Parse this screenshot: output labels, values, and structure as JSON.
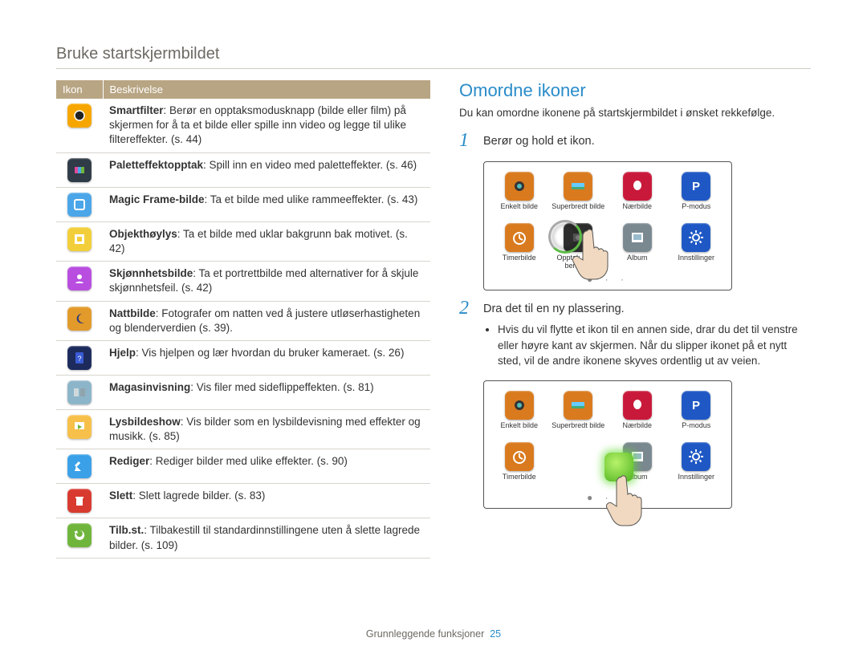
{
  "pageTitle": "Bruke startskjermbildet",
  "footer": {
    "section": "Grunnleggende funksjoner",
    "page": "25"
  },
  "table": {
    "headers": {
      "icon": "Ikon",
      "desc": "Beskrivelse"
    },
    "rows": [
      {
        "term": "Smartfilter",
        "text": ": Berør en opptaksmodusknapp (bilde eller film) på skjermen for å ta et bilde eller spille inn video og legge til ulike filtereffekter. (s. 44)"
      },
      {
        "term": "Paletteffektopptak",
        "text": ": Spill inn en video med paletteffekter. (s. 46)"
      },
      {
        "term": "Magic Frame-bilde",
        "text": ": Ta et bilde med ulike rammeeffekter. (s. 43)"
      },
      {
        "term": "Objekthøylys",
        "text": ": Ta et bilde med uklar bakgrunn bak motivet. (s. 42)"
      },
      {
        "term": "Skjønnhetsbilde",
        "text": ": Ta et portrettbilde med alternativer for å skjule skjønnhetsfeil. (s. 42)"
      },
      {
        "term": "Nattbilde",
        "text": ": Fotografer om natten ved å justere utløserhastigheten og blenderverdien (s. 39)."
      },
      {
        "term": "Hjelp",
        "text": ": Vis hjelpen og lær hvordan du bruker kameraet. (s. 26)"
      },
      {
        "term": "Magasinvisning",
        "text": ": Vis filer med sideflippeffekten. (s. 81)"
      },
      {
        "term": "Lysbildeshow",
        "text": ": Vis bilder som en lysbildevisning med effekter og musikk. (s. 85)"
      },
      {
        "term": "Rediger",
        "text": ": Rediger bilder med ulike effekter. (s. 90)"
      },
      {
        "term": "Slett",
        "text": ": Slett lagrede bilder. (s. 83)"
      },
      {
        "term": "Tilb.st.",
        "text": ": Tilbakestill til standardinnstillingene uten å slette lagrede bilder. (s. 109)"
      }
    ]
  },
  "right": {
    "heading": "Omordne ikoner",
    "desc": "Du kan omordne ikonene på startskjermbildet i ønsket rekkefølge.",
    "step1": {
      "num": "1",
      "text": "Berør og hold et ikon."
    },
    "step2": {
      "num": "2",
      "text": "Dra det til en ny plassering.",
      "bullet": "Hvis du vil flytte et ikon til en annen side, drar du det til venstre eller høyre kant av skjermen. Når du slipper ikonet på et nytt sted, vil de andre ikonene skyves ordentlig ut av veien."
    },
    "apps": {
      "enkelt": "Enkelt bilde",
      "superb": "Superbredt bilde",
      "naer": "Nærbilde",
      "pmodus": "P-modus",
      "timer": "Timerbilde",
      "opptak": "Opptak av én berøring",
      "album": "Album",
      "innst": "Innstillinger"
    },
    "dots": "●  ·  ·"
  },
  "iconColors": {
    "smartfilter": "#f7a600",
    "palett": "#2f3b46",
    "magicframe": "#4aa6e8",
    "objekt": "#f2cf3a",
    "skjonnhet": "#b84de0",
    "natt": "#e29a2b",
    "hjelp": "#1d2a5c",
    "magasin": "#8db5c9",
    "lysbilde": "#f7c04a",
    "rediger": "#3aa0e8",
    "slett": "#d83a2f",
    "tilbst": "#6fb53c"
  },
  "appColors": {
    "enkelt": "#d97a1e",
    "superb": "#d97a1e",
    "naer": "#c9193a",
    "pmodus": "#1f58c4",
    "timer": "#d97a1e",
    "opptak": "#2d2d2d",
    "album": "#7a8890",
    "innst": "#1f58c4"
  }
}
